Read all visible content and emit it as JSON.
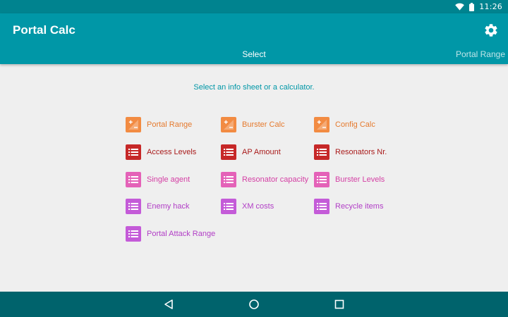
{
  "status_bar": {
    "time": "11:26",
    "icons": [
      "wifi-icon",
      "battery-icon"
    ]
  },
  "app_bar": {
    "title": "Portal Calc",
    "settings_icon": "gear-icon",
    "tabs": [
      {
        "label": "Select",
        "active": true
      },
      {
        "label": "Portal Range",
        "active": false
      }
    ]
  },
  "content": {
    "prompt": "Select an info sheet or a calculator.",
    "items": [
      {
        "label": "Portal Range",
        "icon": "calculator-icon",
        "color": "#f28b42"
      },
      {
        "label": "Burster Calc",
        "icon": "calculator-icon",
        "color": "#f28b42"
      },
      {
        "label": "Config Calc",
        "icon": "calculator-icon",
        "color": "#f28b42"
      },
      {
        "label": "Access Levels",
        "icon": "list-icon",
        "color": "#c62828"
      },
      {
        "label": "AP Amount",
        "icon": "list-icon",
        "color": "#c62828"
      },
      {
        "label": "Resonators Nr.",
        "icon": "list-icon",
        "color": "#c62828"
      },
      {
        "label": "Single agent",
        "icon": "list-icon",
        "color": "#e462b8"
      },
      {
        "label": "Resonator capacity",
        "icon": "list-icon",
        "color": "#e462b8"
      },
      {
        "label": "Burster Levels",
        "icon": "list-icon",
        "color": "#e462b8"
      },
      {
        "label": "Enemy hack",
        "icon": "list-icon",
        "color": "#c45bd8"
      },
      {
        "label": "XM costs",
        "icon": "list-icon",
        "color": "#c45bd8"
      },
      {
        "label": "Recycle items",
        "icon": "list-icon",
        "color": "#c45bd8"
      },
      {
        "label": "Portal Attack Range",
        "icon": "list-icon",
        "color": "#c45bd8"
      }
    ]
  },
  "nav_bar": {
    "buttons": [
      "back-icon",
      "home-icon",
      "recents-icon"
    ]
  },
  "colors": {
    "primary": "#0097a7",
    "primary_dark": "#00838f",
    "nav_bar": "#00636c",
    "background": "#efefef"
  }
}
